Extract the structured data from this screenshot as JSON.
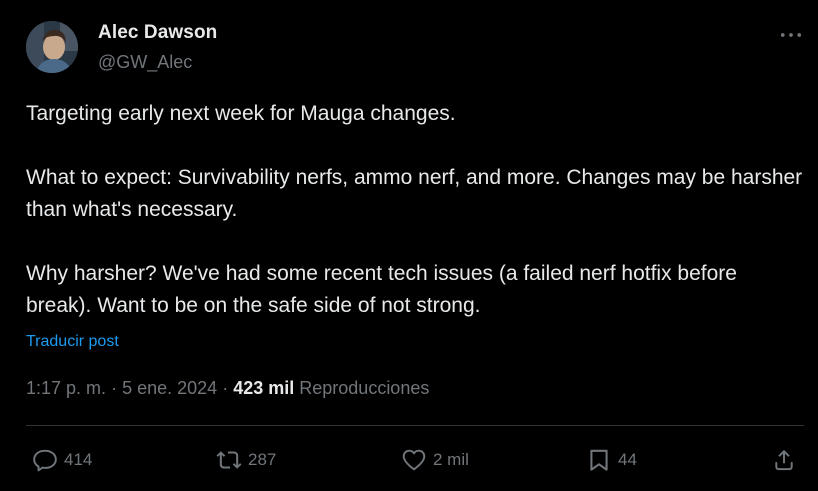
{
  "author": {
    "name": "Alec Dawson",
    "handle": "@GW_Alec",
    "avatar_icon": "user-avatar"
  },
  "tweet": {
    "paragraphs": [
      "Targeting early next week for Mauga changes.",
      "What to expect: Survivability nerfs, ammo nerf, and more. Changes may be harsher than what's necessary.",
      "Why harsher? We've had some recent tech issues (a failed nerf hotfix before break). Want to be on the safe side of not strong."
    ],
    "translate_label": "Traducir post",
    "time": "1:17 p. m.",
    "date": "5 ene. 2024",
    "separator": "·",
    "views_count": "423 mil",
    "views_label": "Reproducciones"
  },
  "actions": {
    "replies": "414",
    "reposts": "287",
    "likes": "2 mil",
    "bookmarks": "44"
  },
  "colors": {
    "background": "#000000",
    "text": "#e7e9ea",
    "secondary": "#71767b",
    "link": "#1d9bf0",
    "divider": "#2f3336"
  }
}
